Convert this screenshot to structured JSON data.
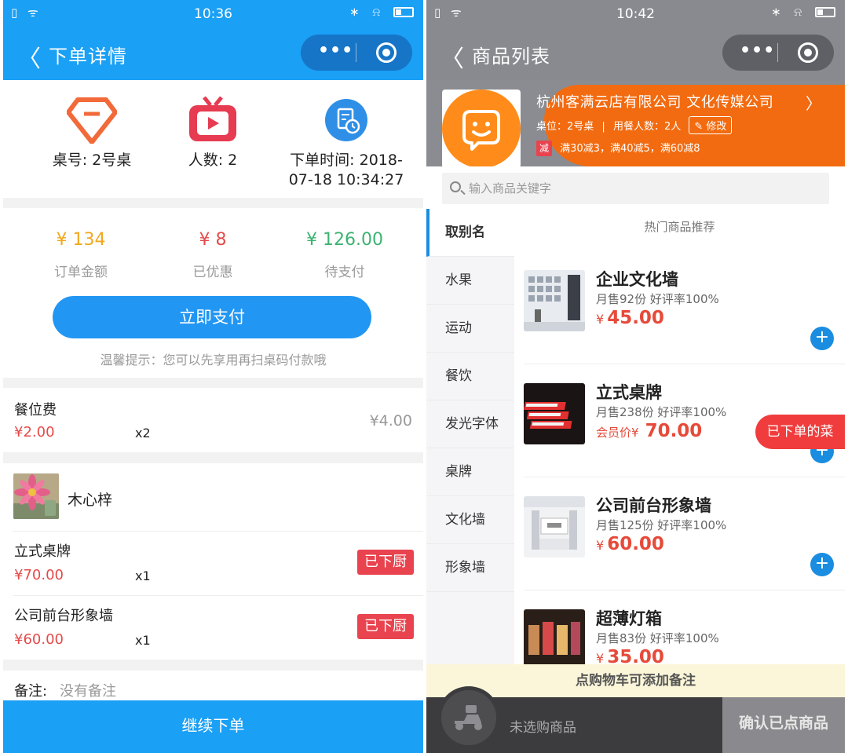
{
  "left": {
    "status": {
      "time": "10:36"
    },
    "nav": {
      "title": "下单详情",
      "more": "•••"
    },
    "info": [
      {
        "icon": "diamond-icon",
        "label": "桌号: 2号桌"
      },
      {
        "icon": "tv-icon",
        "label": "人数: 2"
      },
      {
        "icon": "order-time-icon",
        "label": "下单时间: 2018-07-18 10:34:27"
      }
    ],
    "amounts": [
      {
        "value": "¥ 134",
        "label": "订单金额",
        "color": "#f0a81e"
      },
      {
        "value": "¥ 8",
        "label": "已优惠",
        "color": "#e64a4a"
      },
      {
        "value": "¥ 126.00",
        "label": "待支付",
        "color": "#3cb371"
      }
    ],
    "pay_button": "立即支付",
    "tip": "温馨提示：您可以先享用再扫桌码付款哦",
    "fee": {
      "name": "餐位费",
      "price": "¥2.00",
      "qty": "x2",
      "total": "¥4.00"
    },
    "user": {
      "name": "木心梓"
    },
    "items": [
      {
        "name": "立式桌牌",
        "price": "¥70.00",
        "qty": "x1",
        "status": "已下厨"
      },
      {
        "name": "公司前台形象墙",
        "price": "¥60.00",
        "qty": "x1",
        "status": "已下厨"
      }
    ],
    "remark_label": "备注:",
    "remark_value": "没有备注",
    "continue_button": "继续下单"
  },
  "right": {
    "status": {
      "time": "10:42"
    },
    "nav": {
      "title": "商品列表",
      "more": "•••"
    },
    "shop": {
      "name": "杭州客满云店有限公司  文化传媒公司",
      "table": "桌位：2号桌",
      "diners": "用餐人数：2人",
      "edit": "修改",
      "promo_tag": "减",
      "promo": "满30减3，满40减5，满60减8"
    },
    "search": {
      "placeholder": "输入商品关键字"
    },
    "categories": [
      "取别名",
      "水果",
      "运动",
      "餐饮",
      "发光字体",
      "桌牌",
      "文化墙",
      "形象墙"
    ],
    "active_category": "取别名",
    "hot_title": "热门商品推荐",
    "goods": [
      {
        "name": "企业文化墙",
        "sub": "月售92份 好评率100%",
        "price_prefix": "¥",
        "price": "45.00"
      },
      {
        "name": "立式桌牌",
        "sub": "月售238份 好评率100%",
        "price_prefix": "会员价¥",
        "price": "70.00"
      },
      {
        "name": "公司前台形象墙",
        "sub": "月售125份 好评率100%",
        "price_prefix": "¥",
        "price": "60.00"
      },
      {
        "name": "超薄灯箱",
        "sub": "月售83份 好评率100%",
        "price_prefix": "¥",
        "price": "35.00"
      }
    ],
    "ordered_pill": "已下单的菜",
    "note_bar": "点购物车可添加备注",
    "cart_text": "未选购商品",
    "confirm_button": "确认已点商品"
  }
}
